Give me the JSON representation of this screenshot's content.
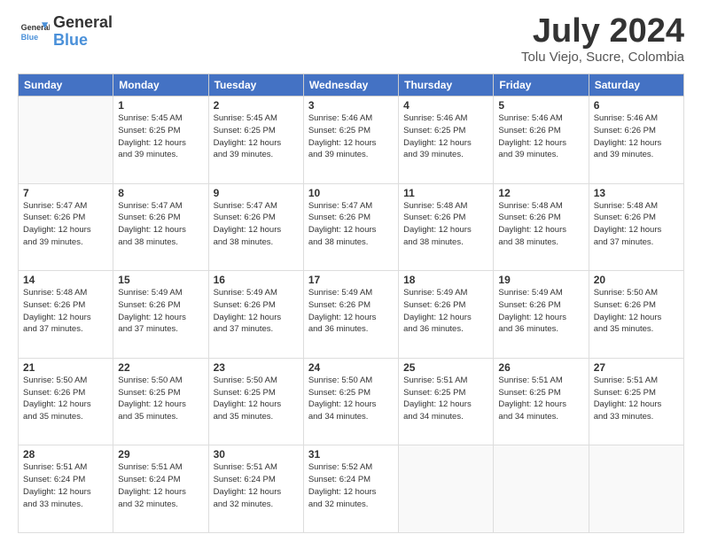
{
  "header": {
    "logo_line1": "General",
    "logo_line2": "Blue",
    "month_year": "July 2024",
    "location": "Tolu Viejo, Sucre, Colombia"
  },
  "weekdays": [
    "Sunday",
    "Monday",
    "Tuesday",
    "Wednesday",
    "Thursday",
    "Friday",
    "Saturday"
  ],
  "weeks": [
    [
      {
        "day": "",
        "info": ""
      },
      {
        "day": "1",
        "info": "Sunrise: 5:45 AM\nSunset: 6:25 PM\nDaylight: 12 hours\nand 39 minutes."
      },
      {
        "day": "2",
        "info": "Sunrise: 5:45 AM\nSunset: 6:25 PM\nDaylight: 12 hours\nand 39 minutes."
      },
      {
        "day": "3",
        "info": "Sunrise: 5:46 AM\nSunset: 6:25 PM\nDaylight: 12 hours\nand 39 minutes."
      },
      {
        "day": "4",
        "info": "Sunrise: 5:46 AM\nSunset: 6:25 PM\nDaylight: 12 hours\nand 39 minutes."
      },
      {
        "day": "5",
        "info": "Sunrise: 5:46 AM\nSunset: 6:26 PM\nDaylight: 12 hours\nand 39 minutes."
      },
      {
        "day": "6",
        "info": "Sunrise: 5:46 AM\nSunset: 6:26 PM\nDaylight: 12 hours\nand 39 minutes."
      }
    ],
    [
      {
        "day": "7",
        "info": "Sunrise: 5:47 AM\nSunset: 6:26 PM\nDaylight: 12 hours\nand 39 minutes."
      },
      {
        "day": "8",
        "info": "Sunrise: 5:47 AM\nSunset: 6:26 PM\nDaylight: 12 hours\nand 38 minutes."
      },
      {
        "day": "9",
        "info": "Sunrise: 5:47 AM\nSunset: 6:26 PM\nDaylight: 12 hours\nand 38 minutes."
      },
      {
        "day": "10",
        "info": "Sunrise: 5:47 AM\nSunset: 6:26 PM\nDaylight: 12 hours\nand 38 minutes."
      },
      {
        "day": "11",
        "info": "Sunrise: 5:48 AM\nSunset: 6:26 PM\nDaylight: 12 hours\nand 38 minutes."
      },
      {
        "day": "12",
        "info": "Sunrise: 5:48 AM\nSunset: 6:26 PM\nDaylight: 12 hours\nand 38 minutes."
      },
      {
        "day": "13",
        "info": "Sunrise: 5:48 AM\nSunset: 6:26 PM\nDaylight: 12 hours\nand 37 minutes."
      }
    ],
    [
      {
        "day": "14",
        "info": "Sunrise: 5:48 AM\nSunset: 6:26 PM\nDaylight: 12 hours\nand 37 minutes."
      },
      {
        "day": "15",
        "info": "Sunrise: 5:49 AM\nSunset: 6:26 PM\nDaylight: 12 hours\nand 37 minutes."
      },
      {
        "day": "16",
        "info": "Sunrise: 5:49 AM\nSunset: 6:26 PM\nDaylight: 12 hours\nand 37 minutes."
      },
      {
        "day": "17",
        "info": "Sunrise: 5:49 AM\nSunset: 6:26 PM\nDaylight: 12 hours\nand 36 minutes."
      },
      {
        "day": "18",
        "info": "Sunrise: 5:49 AM\nSunset: 6:26 PM\nDaylight: 12 hours\nand 36 minutes."
      },
      {
        "day": "19",
        "info": "Sunrise: 5:49 AM\nSunset: 6:26 PM\nDaylight: 12 hours\nand 36 minutes."
      },
      {
        "day": "20",
        "info": "Sunrise: 5:50 AM\nSunset: 6:26 PM\nDaylight: 12 hours\nand 35 minutes."
      }
    ],
    [
      {
        "day": "21",
        "info": "Sunrise: 5:50 AM\nSunset: 6:26 PM\nDaylight: 12 hours\nand 35 minutes."
      },
      {
        "day": "22",
        "info": "Sunrise: 5:50 AM\nSunset: 6:25 PM\nDaylight: 12 hours\nand 35 minutes."
      },
      {
        "day": "23",
        "info": "Sunrise: 5:50 AM\nSunset: 6:25 PM\nDaylight: 12 hours\nand 35 minutes."
      },
      {
        "day": "24",
        "info": "Sunrise: 5:50 AM\nSunset: 6:25 PM\nDaylight: 12 hours\nand 34 minutes."
      },
      {
        "day": "25",
        "info": "Sunrise: 5:51 AM\nSunset: 6:25 PM\nDaylight: 12 hours\nand 34 minutes."
      },
      {
        "day": "26",
        "info": "Sunrise: 5:51 AM\nSunset: 6:25 PM\nDaylight: 12 hours\nand 34 minutes."
      },
      {
        "day": "27",
        "info": "Sunrise: 5:51 AM\nSunset: 6:25 PM\nDaylight: 12 hours\nand 33 minutes."
      }
    ],
    [
      {
        "day": "28",
        "info": "Sunrise: 5:51 AM\nSunset: 6:24 PM\nDaylight: 12 hours\nand 33 minutes."
      },
      {
        "day": "29",
        "info": "Sunrise: 5:51 AM\nSunset: 6:24 PM\nDaylight: 12 hours\nand 32 minutes."
      },
      {
        "day": "30",
        "info": "Sunrise: 5:51 AM\nSunset: 6:24 PM\nDaylight: 12 hours\nand 32 minutes."
      },
      {
        "day": "31",
        "info": "Sunrise: 5:52 AM\nSunset: 6:24 PM\nDaylight: 12 hours\nand 32 minutes."
      },
      {
        "day": "",
        "info": ""
      },
      {
        "day": "",
        "info": ""
      },
      {
        "day": "",
        "info": ""
      }
    ]
  ]
}
